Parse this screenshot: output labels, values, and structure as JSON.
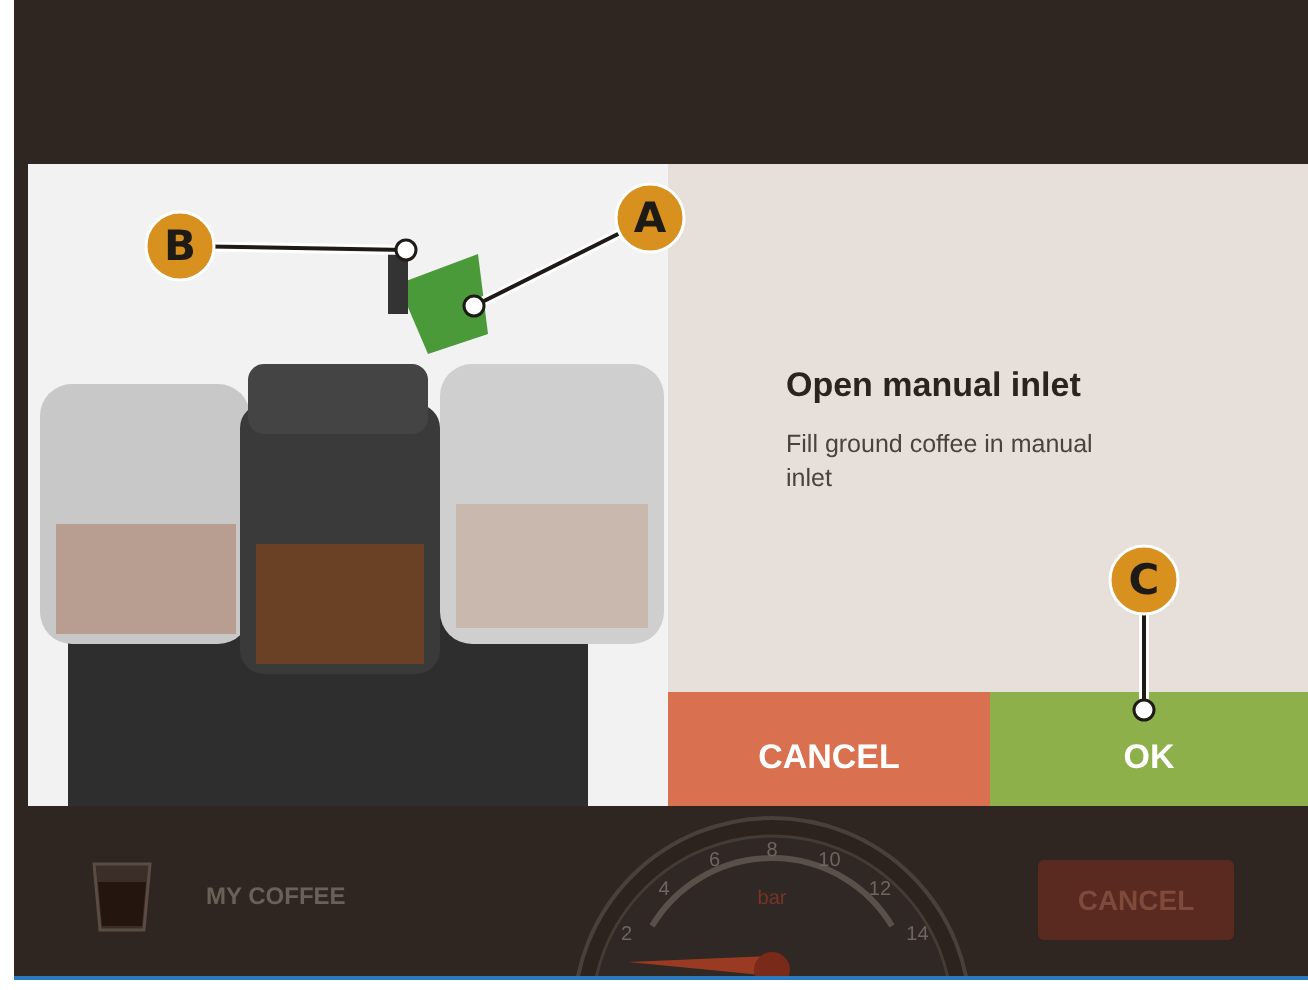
{
  "dialog": {
    "image_callouts": [
      {
        "label": "A"
      },
      {
        "label": "B"
      }
    ],
    "title": "Open manual inlet",
    "message": "Fill ground coffee in manual inlet",
    "buttons": [
      {
        "label": "CANCEL",
        "kind": "cancel"
      },
      {
        "label": "OK",
        "kind": "confirm"
      }
    ],
    "button_callout": {
      "label": "C"
    }
  },
  "background": {
    "product": "MY COFFEE",
    "gauge": {
      "ticks": [
        "2",
        "4",
        "6",
        "8",
        "10",
        "12",
        "14"
      ],
      "unit": "bar"
    },
    "button": "CANCEL"
  }
}
